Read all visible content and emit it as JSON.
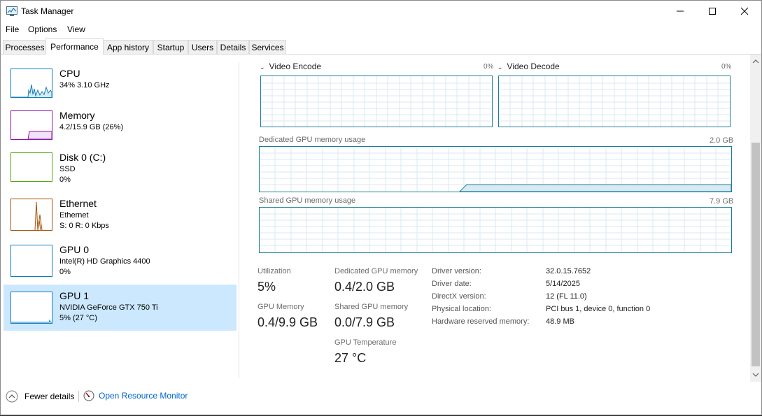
{
  "window": {
    "title": "Task Manager"
  },
  "menu": [
    "File",
    "Options",
    "View"
  ],
  "tabs": [
    "Processes",
    "Performance",
    "App history",
    "Startup",
    "Users",
    "Details",
    "Services"
  ],
  "active_tab": "Performance",
  "resources": [
    {
      "title": "CPU",
      "line1": "34% 3.10 GHz",
      "line2": "",
      "color": "#117dbb"
    },
    {
      "title": "Memory",
      "line1": "4.2/15.9 GB (26%)",
      "line2": "",
      "color": "#8b12ae"
    },
    {
      "title": "Disk 0 (C:)",
      "line1": "SSD",
      "line2": "0%",
      "color": "#4da60c"
    },
    {
      "title": "Ethernet",
      "line1": "Ethernet",
      "line2": "S: 0 R: 0 Kbps",
      "color": "#a74f01"
    },
    {
      "title": "GPU 0",
      "line1": "Intel(R) HD Graphics 4400",
      "line2": "0%",
      "color": "#117dbb"
    },
    {
      "title": "GPU 1",
      "line1": "NVIDIA GeForce GTX 750 Ti",
      "line2": "5% (27 °C)",
      "color": "#117dbb"
    }
  ],
  "selected_resource": "GPU 1",
  "detail": {
    "video_encode": {
      "label": "Video Encode",
      "pct": "0%"
    },
    "video_decode": {
      "label": "Video Decode",
      "pct": "0%"
    },
    "dedicated": {
      "label": "Dedicated GPU memory usage",
      "max": "2.0 GB"
    },
    "shared": {
      "label": "Shared GPU memory usage",
      "max": "7.9 GB"
    },
    "stats": {
      "utilization": {
        "label": "Utilization",
        "value": "5%"
      },
      "gpu_memory": {
        "label": "GPU Memory",
        "value": "0.4/9.9 GB"
      },
      "dedicated_mem": {
        "label": "Dedicated GPU memory",
        "value": "0.4/2.0 GB"
      },
      "shared_mem": {
        "label": "Shared GPU memory",
        "value": "0.0/7.9 GB"
      },
      "temperature": {
        "label": "GPU Temperature",
        "value": "27 °C"
      }
    },
    "info": [
      {
        "k": "Driver version:",
        "v": "32.0.15.7652"
      },
      {
        "k": "Driver date:",
        "v": "5/14/2025"
      },
      {
        "k": "DirectX version:",
        "v": "12 (FL 11.0)"
      },
      {
        "k": "Physical location:",
        "v": "PCI bus 1, device 0, function 0"
      },
      {
        "k": "Hardware reserved memory:",
        "v": "48.9 MB"
      }
    ]
  },
  "footer": {
    "fewer_details": "Fewer details",
    "open_monitor": "Open Resource Monitor"
  },
  "colors": {
    "graph_border": "#1e7f9b",
    "selected_bg": "#cce8ff",
    "link": "#0066cc"
  }
}
